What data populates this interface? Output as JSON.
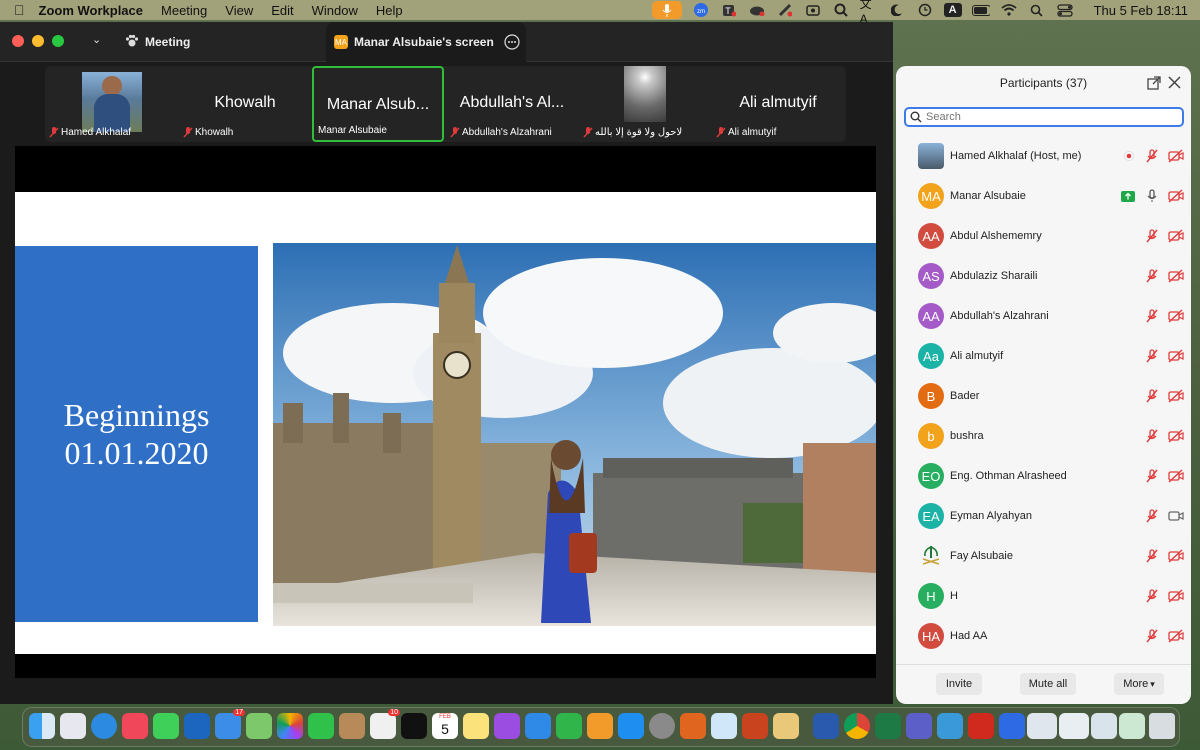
{
  "menubar": {
    "app": "Zoom Workplace",
    "items": [
      "Meeting",
      "View",
      "Edit",
      "Window",
      "Help"
    ],
    "clock": "Thu 5 Feb  18:11",
    "tray_a": "A"
  },
  "window": {
    "meeting_tab": "Meeting",
    "screen_tab": "Manar Alsubaie's screen",
    "screen_tab_badge": "MA"
  },
  "gallery": [
    {
      "big": "",
      "label": "Hamed Alkhalaf",
      "muted": true
    },
    {
      "big": "Khowalh",
      "label": "Khowalh",
      "muted": true
    },
    {
      "big": "Manar Alsub...",
      "label": "Manar Alsubaie",
      "muted": false
    },
    {
      "big": "Abdullah's Al...",
      "label": "Abdullah's Alzahrani",
      "muted": true
    },
    {
      "big": "",
      "label": "لاحول ولا قوة إلا بالله",
      "muted": true
    },
    {
      "big": "Ali almutyif",
      "label": "Ali almutyif",
      "muted": true
    }
  ],
  "slide": {
    "title_line1": "Beginnings",
    "title_line2": "01.01.2020"
  },
  "participants": {
    "header": "Participants (37)",
    "search_placeholder": "Search",
    "list": [
      {
        "initials": "",
        "name": "Hamed Alkhalaf (Host, me)",
        "color": "#6b7b8c",
        "photo": true
      },
      {
        "initials": "MA",
        "name": "Manar Alsubaie",
        "color": "#f2a31b",
        "sharing": true
      },
      {
        "initials": "AA",
        "name": "Abdul Alshememry",
        "color": "#d14b3f"
      },
      {
        "initials": "AS",
        "name": "Abdulaziz Sharaili",
        "color": "#a45bc7"
      },
      {
        "initials": "AA",
        "name": "Abdullah's Alzahrani",
        "color": "#a45bc7"
      },
      {
        "initials": "Aa",
        "name": "Ali almutyif",
        "color": "#1bb3a6"
      },
      {
        "initials": "B",
        "name": "Bader",
        "color": "#e36c13"
      },
      {
        "initials": "b",
        "name": "bushra",
        "color": "#f2a31b"
      },
      {
        "initials": "EO",
        "name": "Eng. Othman Alrasheed",
        "color": "#27ae60"
      },
      {
        "initials": "EA",
        "name": "Eyman Alyahyan",
        "color": "#1bb3a6",
        "video_on": true
      },
      {
        "initials": "",
        "name": "Fay Alsubaie",
        "color": "#f6f6f6",
        "emblem": true
      },
      {
        "initials": "H",
        "name": "H",
        "color": "#27ae60"
      },
      {
        "initials": "HA",
        "name": "Had AA",
        "color": "#d14b3f"
      }
    ],
    "footer": {
      "invite": "Invite",
      "mute_all": "Mute all",
      "more": "More"
    }
  },
  "dock": {
    "calendar_month": "FEB",
    "calendar_day": "5",
    "mail_badge": "17",
    "news_badge": "10"
  }
}
